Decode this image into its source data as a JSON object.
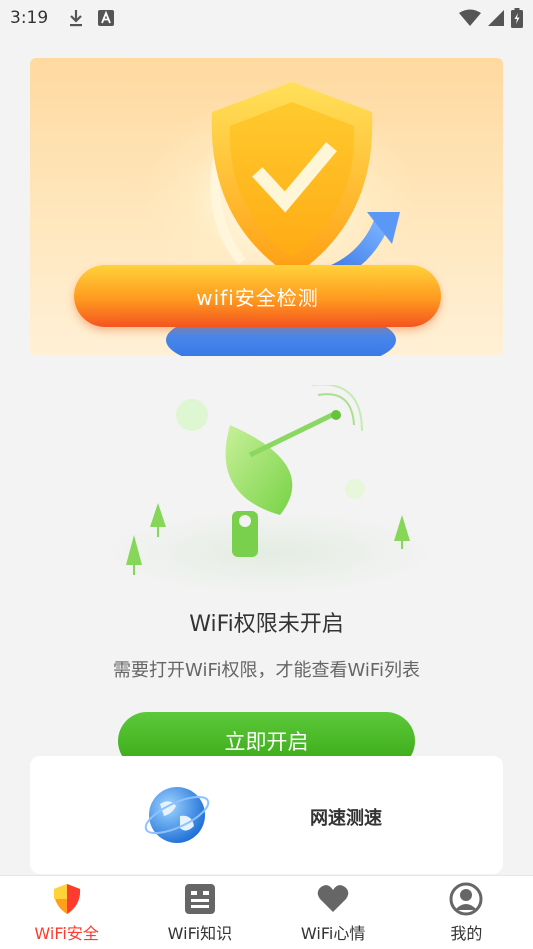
{
  "status_bar": {
    "time": "3:19"
  },
  "hero": {
    "scan_button_label": "wifi安全检测"
  },
  "permission": {
    "title": "WiFi权限未开启",
    "description": "需要打开WiFi权限，才能查看WiFi列表",
    "button_label": "立即开启"
  },
  "speed_card": {
    "label": "网速测速"
  },
  "bottom_nav": {
    "items": [
      {
        "label": "WiFi安全",
        "icon": "shield-icon",
        "active": true
      },
      {
        "label": "WiFi知识",
        "icon": "document-icon",
        "active": false
      },
      {
        "label": "WiFi心情",
        "icon": "heart-icon",
        "active": false
      },
      {
        "label": "我的",
        "icon": "person-icon",
        "active": false
      }
    ]
  },
  "colors": {
    "accent_active": "#ff3b2f",
    "open_button": "#44b020",
    "scan_button": "#ff9a1f"
  }
}
